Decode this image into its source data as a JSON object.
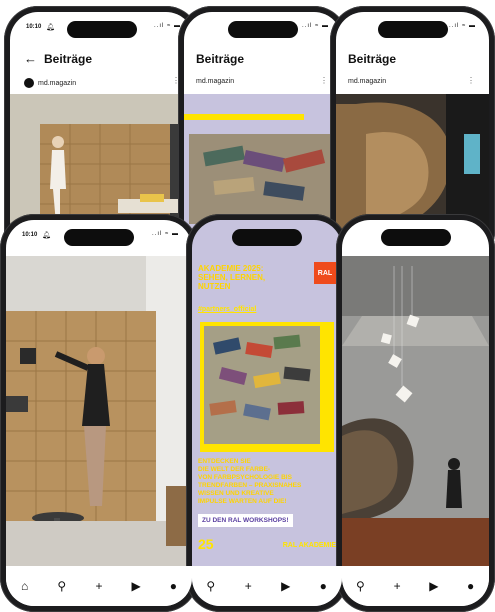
{
  "status_bar": {
    "time": "10:10",
    "signal_icons": "..ıl ≈ ▬"
  },
  "post_header": {
    "back_icon": "arrow-left-icon",
    "title": "Beiträge"
  },
  "account": {
    "name": "md.magazin",
    "more_icon": "ellipsis-vertical-icon"
  },
  "workshop_post": {
    "heading": "AKADEMIE 2025:\nSEHEN, LERNEN,\nNUTZEN",
    "logo": "RAL",
    "handle": "#partners_official",
    "body_text": "ENTDECKEN SIE\nDIE WELT DER FARBE-\nVON FARBPSYCHOLOGIE BIS\nTRENDFARBEN – PRAXISNAHES\nWISSEN UND KREATIVE\nIMPULSE WARTEN AUF DIE!",
    "cta": "ZU DEN RAL WORKSHOPS!",
    "year": "25",
    "footer": "RAL AKADEMIE"
  },
  "nav_icons": [
    "home-icon",
    "search-icon",
    "create-icon",
    "reels-icon",
    "profile-icon"
  ],
  "nav_glyphs": {
    "home": "⌂",
    "search": "⚲",
    "create": "+",
    "reels": "▶",
    "profile": "●"
  },
  "colors": {
    "phone_frame": "#1c1c1e",
    "lilac": "#c7c3de",
    "accent_yellow": "#ffe400",
    "ral_orange": "#ef4b1c",
    "cta_bg": "#ffffff",
    "wood": "#b38e5f",
    "dark_wall": "#2b2b2b"
  }
}
